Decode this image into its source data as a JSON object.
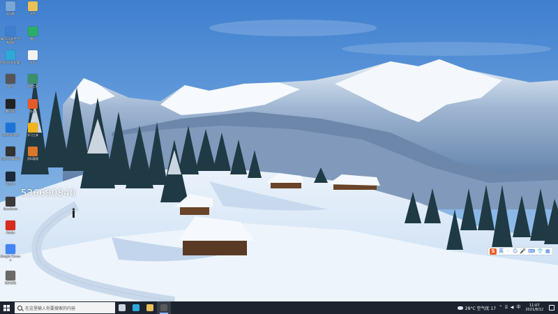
{
  "overlay_number": "536690840",
  "desktop_icons": [
    {
      "label": "此电脑",
      "icon": "computer-icon",
      "color": "#7aa7d9"
    },
    {
      "label": "文件",
      "icon": "folder-icon",
      "color": "#e8c15a"
    },
    {
      "label": "编号01 软件 控制面板",
      "icon": "control-panel-icon",
      "color": "#3f7fd1"
    },
    {
      "label": "微信",
      "icon": "wechat-icon",
      "color": "#2aae67"
    },
    {
      "label": "Microsoft Edge",
      "icon": "edge-icon",
      "color": "#2fa8d8"
    },
    {
      "label": "文档",
      "icon": "document-icon",
      "color": "#f2f2f2"
    },
    {
      "label": "软件",
      "icon": "app-icon",
      "color": "#555555"
    },
    {
      "label": "软件工具",
      "icon": "tool-icon",
      "color": "#3d8f6a"
    },
    {
      "label": "腾讯QQ",
      "icon": "qq-icon",
      "color": "#222222"
    },
    {
      "label": "办公",
      "icon": "office-icon",
      "color": "#e55a2b"
    },
    {
      "label": "TeamViewer",
      "icon": "teamviewer-icon",
      "color": "#1b74d8"
    },
    {
      "label": "学习工具",
      "icon": "study-icon",
      "color": "#f0b41c"
    },
    {
      "label": "Typora 编辑器",
      "icon": "editor-icon",
      "color": "#333333"
    },
    {
      "label": "资料管理",
      "icon": "files-icon",
      "color": "#d9782a"
    },
    {
      "label": "Steam",
      "icon": "steam-icon",
      "color": "#1b2838"
    },
    {
      "label": "Bandicam",
      "icon": "recorder-icon",
      "color": "#3a3a3a"
    },
    {
      "label": "Adobe",
      "icon": "adobe-icon",
      "color": "#d62d20"
    },
    {
      "label": "Google Chrome",
      "icon": "chrome-icon",
      "color": "#4285f4"
    },
    {
      "label": "软件安装",
      "icon": "installer-icon",
      "color": "#6a6a6a"
    }
  ],
  "ime": {
    "logo": "S",
    "items": [
      "英",
      "·",
      "☺",
      "🎤",
      "⌨",
      "👕",
      "▦"
    ]
  },
  "taskbar": {
    "search_placeholder": "在这里输入你要搜索的内容",
    "apps": [
      {
        "name": "task-view",
        "color": "#cfd6e0"
      },
      {
        "name": "edge",
        "color": "#2fa8d8"
      },
      {
        "name": "file-explorer",
        "color": "#e8c15a"
      },
      {
        "name": "recorder",
        "color": "#5a5a5a"
      }
    ],
    "weather": "28°C 空气优 17",
    "time": "11:07",
    "date": "2021/8/12"
  }
}
